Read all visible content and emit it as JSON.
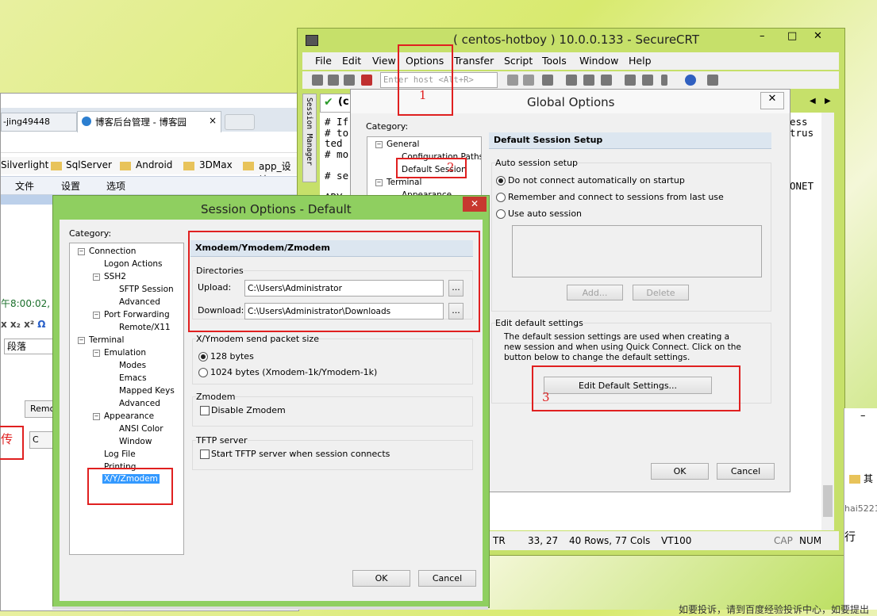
{
  "browser": {
    "tab_left": "-jing49448",
    "tab_active": "博客后台管理 - 博客园",
    "bookmarks": [
      "Silverlight",
      "SqlServer",
      "Android",
      "3DMax",
      "app_设计"
    ],
    "editor_menu": [
      "文件",
      "设置",
      "选项"
    ],
    "side_text_time": "午8:00:02,",
    "side_text_para": "段落",
    "side_remov": "Remo",
    "side_chuan": "传"
  },
  "securecrt": {
    "title": "( centos-hotboy ) 10.0.0.133 - SecureCRT",
    "menu": [
      "File",
      "Edit",
      "View",
      "Options",
      "Transfer",
      "Script",
      "Tools",
      "Window",
      "Help"
    ],
    "host_placeholder": "Enter host <Alt+R>",
    "side_tab": "Session Manager",
    "term_lines": [
      "# If",
      "# to",
      "ted",
      "# mo",
      "",
      "# se",
      "",
      "ARY"
    ],
    "term_right": [
      "ess",
      "trus",
      "",
      "",
      "ONET"
    ],
    "status": [
      "TR",
      "33, 27",
      "40 Rows, 77 Cols",
      "VT100",
      "CAP",
      "NUM"
    ],
    "right_text": "行",
    "right_text2": "hai5221",
    "right_text3": "其"
  },
  "global_options": {
    "title": "Global Options",
    "category_label": "Category:",
    "tree": [
      "General",
      "Configuration Paths",
      "Default Session",
      "Terminal",
      "Appearance"
    ],
    "section_title": "Default Session Setup",
    "auto_group": "Auto session setup",
    "radio1": "Do not connect automatically on startup",
    "radio2": "Remember and connect to sessions from last use",
    "radio3": "Use auto session",
    "add_btn": "Add...",
    "delete_btn": "Delete",
    "edit_group": "Edit default settings",
    "edit_desc": "The default session settings are used when creating a new session and when using Quick Connect.  Click on the button below to change the default settings.",
    "edit_btn": "Edit Default Settings...",
    "ok": "OK",
    "cancel": "Cancel"
  },
  "session_options": {
    "title": "Session Options - Default",
    "category_label": "Category:",
    "tree": [
      "Connection",
      "Logon Actions",
      "SSH2",
      "SFTP Session",
      "Advanced",
      "Port Forwarding",
      "Remote/X11",
      "Terminal",
      "Emulation",
      "Modes",
      "Emacs",
      "Mapped Keys",
      "Advanced",
      "Appearance",
      "ANSI Color",
      "Window",
      "Log File",
      "Printing",
      "X/Y/Zmodem"
    ],
    "section_title": "Xmodem/Ymodem/Zmodem",
    "dir_group": "Directories",
    "upload_label": "Upload:",
    "upload_value": "C:\\Users\\Administrator",
    "download_label": "Download:",
    "download_value": "C:\\Users\\Administrator\\Downloads",
    "browse": "...",
    "packet_group": "X/Ymodem send packet size",
    "packet1": "128 bytes",
    "packet2": "1024 bytes  (Xmodem-1k/Ymodem-1k)",
    "zmodem_group": "Zmodem",
    "zmodem_check": "Disable Zmodem",
    "tftp_group": "TFTP server",
    "tftp_check": "Start TFTP server when session connects",
    "ok": "OK",
    "cancel": "Cancel"
  },
  "annotations": [
    "1",
    "2",
    "3",
    "3"
  ],
  "bottom_text": "如要投诉，请到百度经验投诉中心，如要提出"
}
